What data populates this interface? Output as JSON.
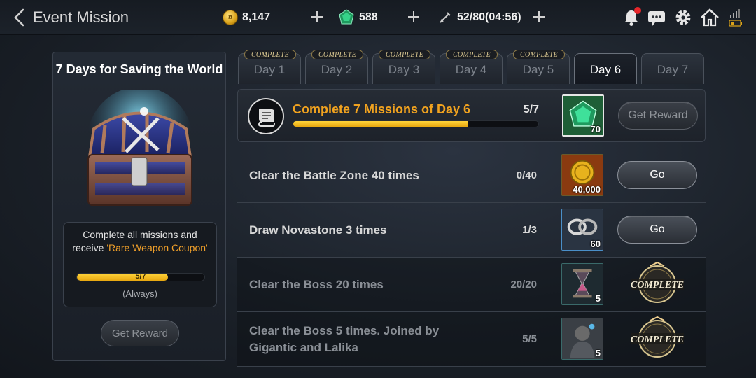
{
  "header": {
    "title": "Event Mission",
    "gold": "8,147",
    "gems": "588",
    "stamina": "52/80(04:56)"
  },
  "left_panel": {
    "title": "7 Days for Saving the World",
    "desc_line1": "Complete all missions and",
    "desc_line2_prefix": "receive ",
    "desc_highlight": "'Rare Weapon Coupon'",
    "progress_text": "5/7",
    "progress_fraction": 0.714,
    "always": "(Always)",
    "reward_button": "Get Reward"
  },
  "tabs": [
    {
      "label": "Day 1",
      "badge": "COMPLETE"
    },
    {
      "label": "Day 2",
      "badge": "COMPLETE"
    },
    {
      "label": "Day 3",
      "badge": "COMPLETE"
    },
    {
      "label": "Day 4",
      "badge": "COMPLETE"
    },
    {
      "label": "Day 5",
      "badge": "COMPLETE"
    },
    {
      "label": "Day 6",
      "badge": ""
    },
    {
      "label": "Day 7",
      "badge": ""
    }
  ],
  "active_tab": "Day 6",
  "day_mission": {
    "title": "Complete 7 Missions of Day 6",
    "count": "5/7",
    "progress_fraction": 0.714,
    "reward_amount": "70",
    "button": "Get Reward"
  },
  "missions": [
    {
      "name": "Clear the Battle Zone 40 times",
      "name_line2": "",
      "progress": "0/40",
      "reward_amount": "40,000",
      "reward_icon": "gold-coin-icon",
      "action": "Go",
      "status": "open"
    },
    {
      "name": "Draw Novastone 3 times",
      "name_line2": "",
      "progress": "1/3",
      "reward_amount": "60",
      "reward_icon": "silver-ring-icon",
      "action": "Go",
      "status": "open"
    },
    {
      "name": "Clear the Boss 20 times",
      "name_line2": "",
      "progress": "20/20",
      "reward_amount": "5",
      "reward_icon": "hourglass-icon",
      "action": "COMPLETE",
      "status": "complete"
    },
    {
      "name": "Clear the Boss 5 times. Joined by",
      "name_line2": "Gigantic and Lalika",
      "progress": "5/5",
      "reward_amount": "5",
      "reward_icon": "warrior-portrait-icon",
      "action": "COMPLETE",
      "status": "complete"
    }
  ],
  "colors": {
    "accent_orange": "#f0a21f",
    "progress_yellow": "#ffd43a",
    "notification_red": "#e8262a"
  }
}
